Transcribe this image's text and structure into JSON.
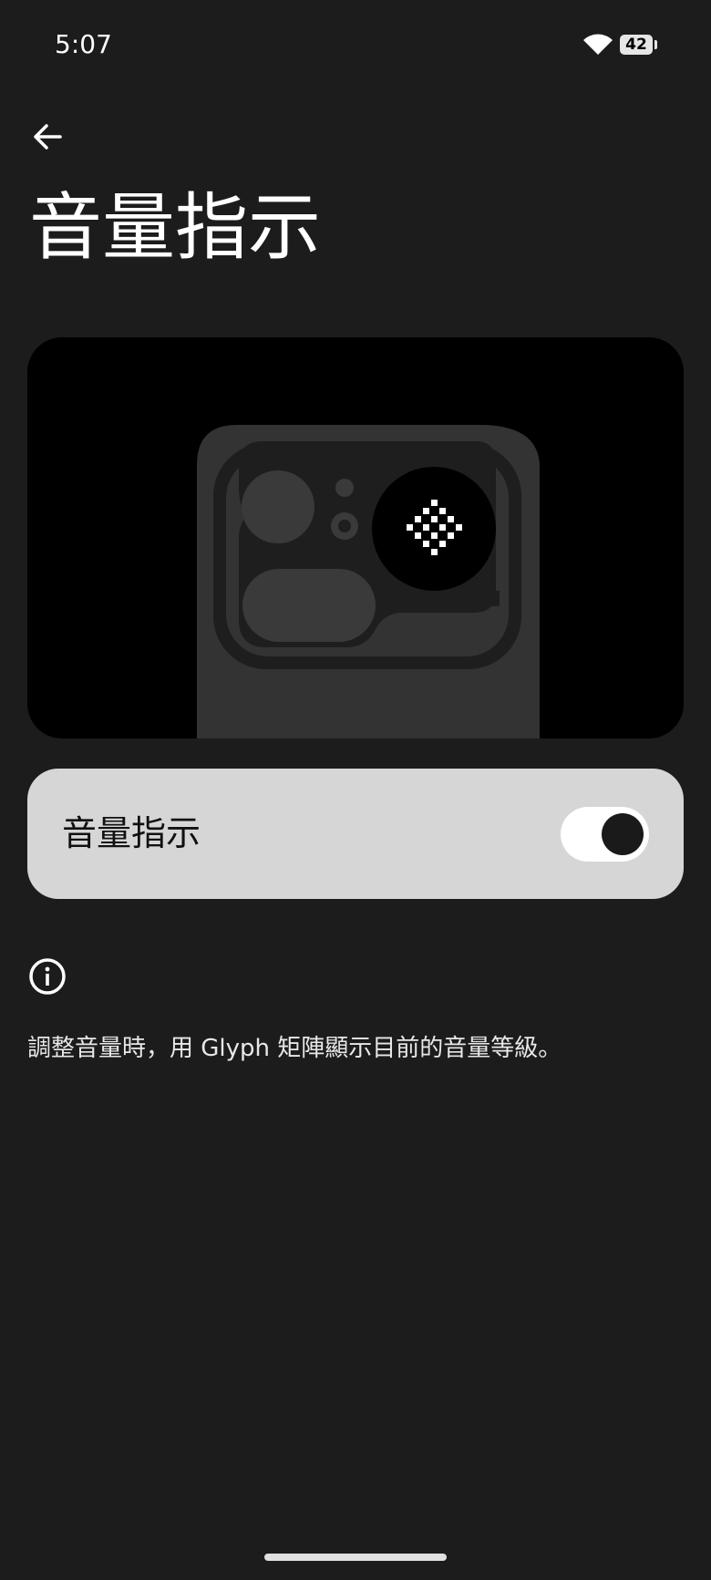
{
  "status_bar": {
    "time": "5:07",
    "battery_level": "42",
    "wifi_icon": "wifi-icon"
  },
  "header": {
    "back_icon": "arrow-left-icon",
    "title": "音量指示"
  },
  "preview": {
    "description_icon": "phone-camera-glyph-illustration"
  },
  "setting": {
    "label": "音量指示",
    "enabled": true
  },
  "info": {
    "icon": "info-icon",
    "text": "調整音量時，用 Glyph 矩陣顯示目前的音量等級。"
  },
  "colors": {
    "background": "#1c1c1c",
    "card": "#d6d6d6",
    "preview_bg": "#000000",
    "phone_body": "#333333"
  }
}
